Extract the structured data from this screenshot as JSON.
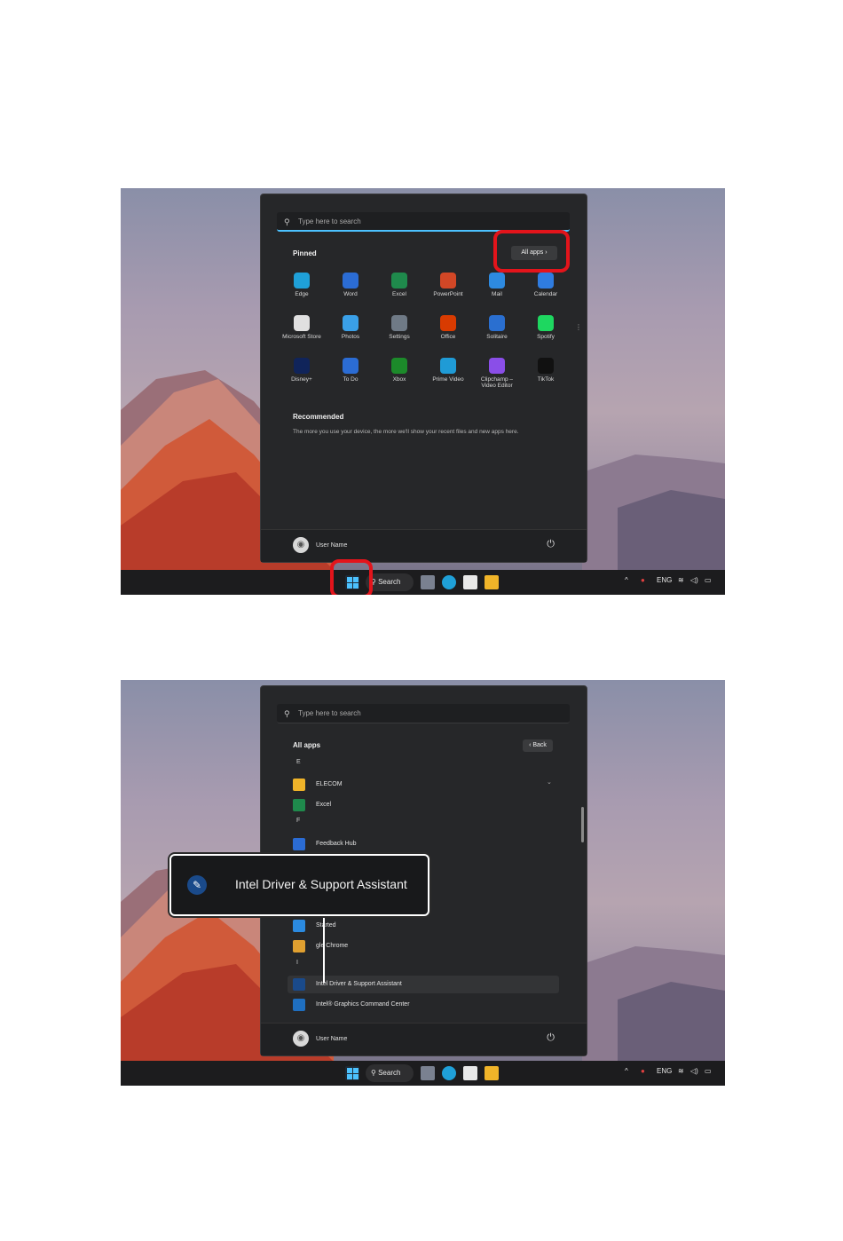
{
  "shot1": {
    "search_placeholder": "Type here to search",
    "pinned_title": "Pinned",
    "all_apps_label": "All apps",
    "apps": [
      {
        "label": "Edge",
        "icon": "edge-icon",
        "color": "#1fa0d8"
      },
      {
        "label": "Word",
        "icon": "word-icon",
        "color": "#2b6cd4"
      },
      {
        "label": "Excel",
        "icon": "excel-icon",
        "color": "#1f8a4c"
      },
      {
        "label": "PowerPoint",
        "icon": "powerpoint-icon",
        "color": "#d24726"
      },
      {
        "label": "Mail",
        "icon": "mail-icon",
        "color": "#2d8ae0"
      },
      {
        "label": "Calendar",
        "icon": "calendar-icon",
        "color": "#2f7ce0"
      },
      {
        "label": "Microsoft Store",
        "icon": "store-icon",
        "color": "#e0e0e0"
      },
      {
        "label": "Photos",
        "icon": "photos-icon",
        "color": "#3aa0e8"
      },
      {
        "label": "Settings",
        "icon": "settings-icon",
        "color": "#6f7a86"
      },
      {
        "label": "Office",
        "icon": "office-icon",
        "color": "#d83b01"
      },
      {
        "label": "Solitaire",
        "icon": "solitaire-icon",
        "color": "#2a6fd0"
      },
      {
        "label": "Spotify",
        "icon": "spotify-icon",
        "color": "#1ed760"
      },
      {
        "label": "Disney+",
        "icon": "disney-icon",
        "color": "#10245a"
      },
      {
        "label": "To Do",
        "icon": "todo-icon",
        "color": "#2b6cd4"
      },
      {
        "label": "Xbox",
        "icon": "xbox-icon",
        "color": "#1c8a2a"
      },
      {
        "label": "Prime Video",
        "icon": "prime-video-icon",
        "color": "#1f9bd6"
      },
      {
        "label": "Clipchamp – Video Editor",
        "icon": "clipchamp-icon",
        "color": "#8a4ee8"
      },
      {
        "label": "TikTok",
        "icon": "tiktok-icon",
        "color": "#111111"
      }
    ],
    "recommended_title": "Recommended",
    "recommended_text": "The more you use your device, the more we'll show your recent files and new apps here.",
    "user_name": "User Name"
  },
  "taskbar": {
    "search_label": "Search",
    "tray_lang": "ENG"
  },
  "shot2": {
    "search_placeholder": "Type here to search",
    "all_apps_title": "All apps",
    "back_label": "Back",
    "rows": [
      {
        "type": "letter",
        "text": "E"
      },
      {
        "type": "app",
        "label": "ELECOM",
        "icon": "folder-icon",
        "color": "#f0b429"
      },
      {
        "type": "app",
        "label": "Excel",
        "icon": "excel-icon",
        "color": "#1f8a4c"
      },
      {
        "type": "letter",
        "text": "F"
      },
      {
        "type": "app",
        "label": "Feedback Hub",
        "icon": "feedback-hub-icon",
        "color": "#2b6cd4"
      },
      {
        "type": "app",
        "label": "Started",
        "icon": "get-started-icon",
        "color": "#2b8ae0"
      },
      {
        "type": "app",
        "label": "gle Chrome",
        "icon": "chrome-icon",
        "color": "#e0a030"
      },
      {
        "type": "letter",
        "text": "I"
      },
      {
        "type": "app",
        "label": "Intel Driver & Support Assistant",
        "icon": "intel-dsa-icon",
        "color": "#1a4a8a"
      },
      {
        "type": "app",
        "label": "Intel® Graphics Command Center",
        "icon": "intel-graphics-icon",
        "color": "#1f6fc0"
      }
    ],
    "user_name": "User Name",
    "callout_label": "Intel Driver & Support Assistant"
  }
}
